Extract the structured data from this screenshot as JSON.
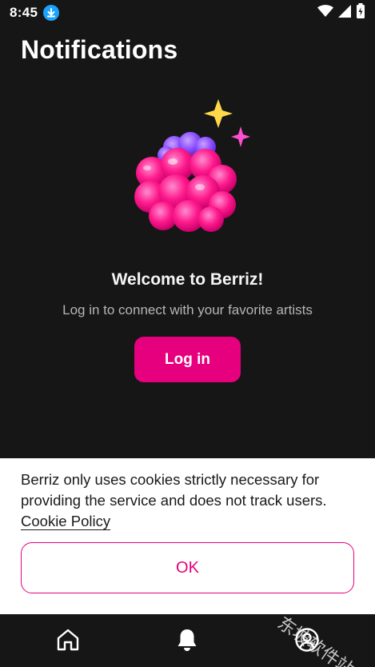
{
  "status_bar": {
    "time": "8:45",
    "icons": [
      "download-icon",
      "wifi-icon",
      "signal-icon",
      "battery-icon"
    ]
  },
  "header": {
    "title": "Notifications"
  },
  "empty_state": {
    "title": "Welcome to Berriz!",
    "subtitle": "Log in to connect with your favorite artists",
    "login_label": "Log in",
    "art": "berry-illustration"
  },
  "cookie_banner": {
    "text": "Berriz only uses cookies strictly necessary for providing the service and does not track users.",
    "policy_link": "Cookie Policy",
    "ok_label": "OK"
  },
  "bottom_nav": {
    "items": [
      {
        "icon": "home-icon"
      },
      {
        "icon": "bell-icon",
        "active": true
      },
      {
        "icon": "profile-icon"
      }
    ]
  },
  "watermark": "东坡软件站",
  "colors": {
    "background": "#161616",
    "accent": "#e6007e",
    "sheet": "#ffffff"
  }
}
